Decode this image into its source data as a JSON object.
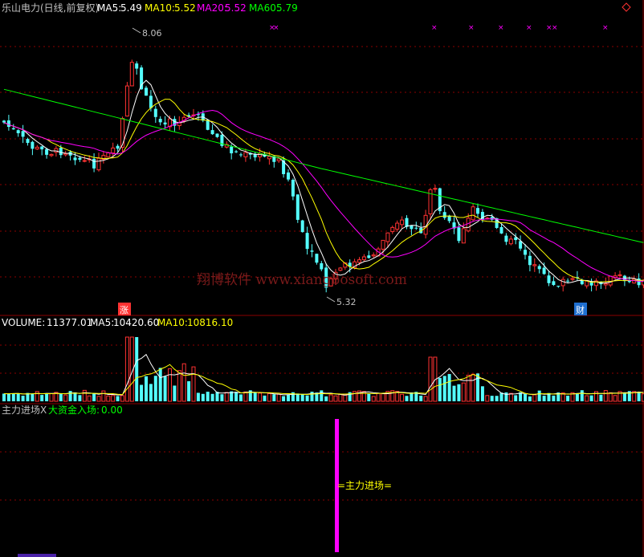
{
  "header": {
    "title": "乐山电力(日线,前复权)",
    "ma5_label": "MA5:",
    "ma5_value": "5.49",
    "ma10_label": "MA10:",
    "ma10_value": "5.52",
    "ma20_label": "MA20:",
    "ma20_value": "5.52",
    "ma60_label": "MA60:",
    "ma60_value": "5.79"
  },
  "watermark": "翔博软件 www.xiangbosoft.com",
  "annotations": {
    "high_label": "8.06",
    "low_label": "5.32",
    "zhang_marker": "涨",
    "cai_marker": "财"
  },
  "volume_header": {
    "volume_label": "VOLUME:",
    "volume_value": "11377.01",
    "ma5_label": "MA5:",
    "ma5_value": "10420.60",
    "ma10_label": "MA10:",
    "ma10_value": "10816.10"
  },
  "indicator_header": {
    "label1": "主力进场X",
    "label2": "大资金入场:",
    "value2": "0.00"
  },
  "indicator_text": "=主力进场=",
  "colors": {
    "up": "#ff3232",
    "down": "#54ffff",
    "ma5": "#ffffff",
    "ma10": "#ffff00",
    "ma20": "#ff00ff",
    "ma60": "#00ff00",
    "grid": "#8b0000",
    "signal_bar": "#ff00ff",
    "x_marker": "#ff00ff"
  },
  "chart_data": [
    {
      "type": "candlestick",
      "title": "乐山电力(日线,前复权)",
      "series": [
        {
          "name": "MA5",
          "value": 5.49
        },
        {
          "name": "MA10",
          "value": 5.52
        },
        {
          "name": "MA20",
          "value": 5.52
        },
        {
          "name": "MA60",
          "value": 5.79
        }
      ],
      "annotations": [
        {
          "text": "8.06",
          "kind": "period-high"
        },
        {
          "text": "5.32",
          "kind": "period-low"
        }
      ]
    },
    {
      "type": "bar",
      "title": "VOLUME",
      "series": [
        {
          "name": "VOLUME",
          "value": 11377.01
        },
        {
          "name": "MA5",
          "value": 10420.6
        },
        {
          "name": "MA10",
          "value": 10816.1
        }
      ]
    },
    {
      "type": "bar",
      "title": "主力进场X",
      "series": [
        {
          "name": "大资金入场",
          "value": 0.0
        }
      ]
    }
  ]
}
